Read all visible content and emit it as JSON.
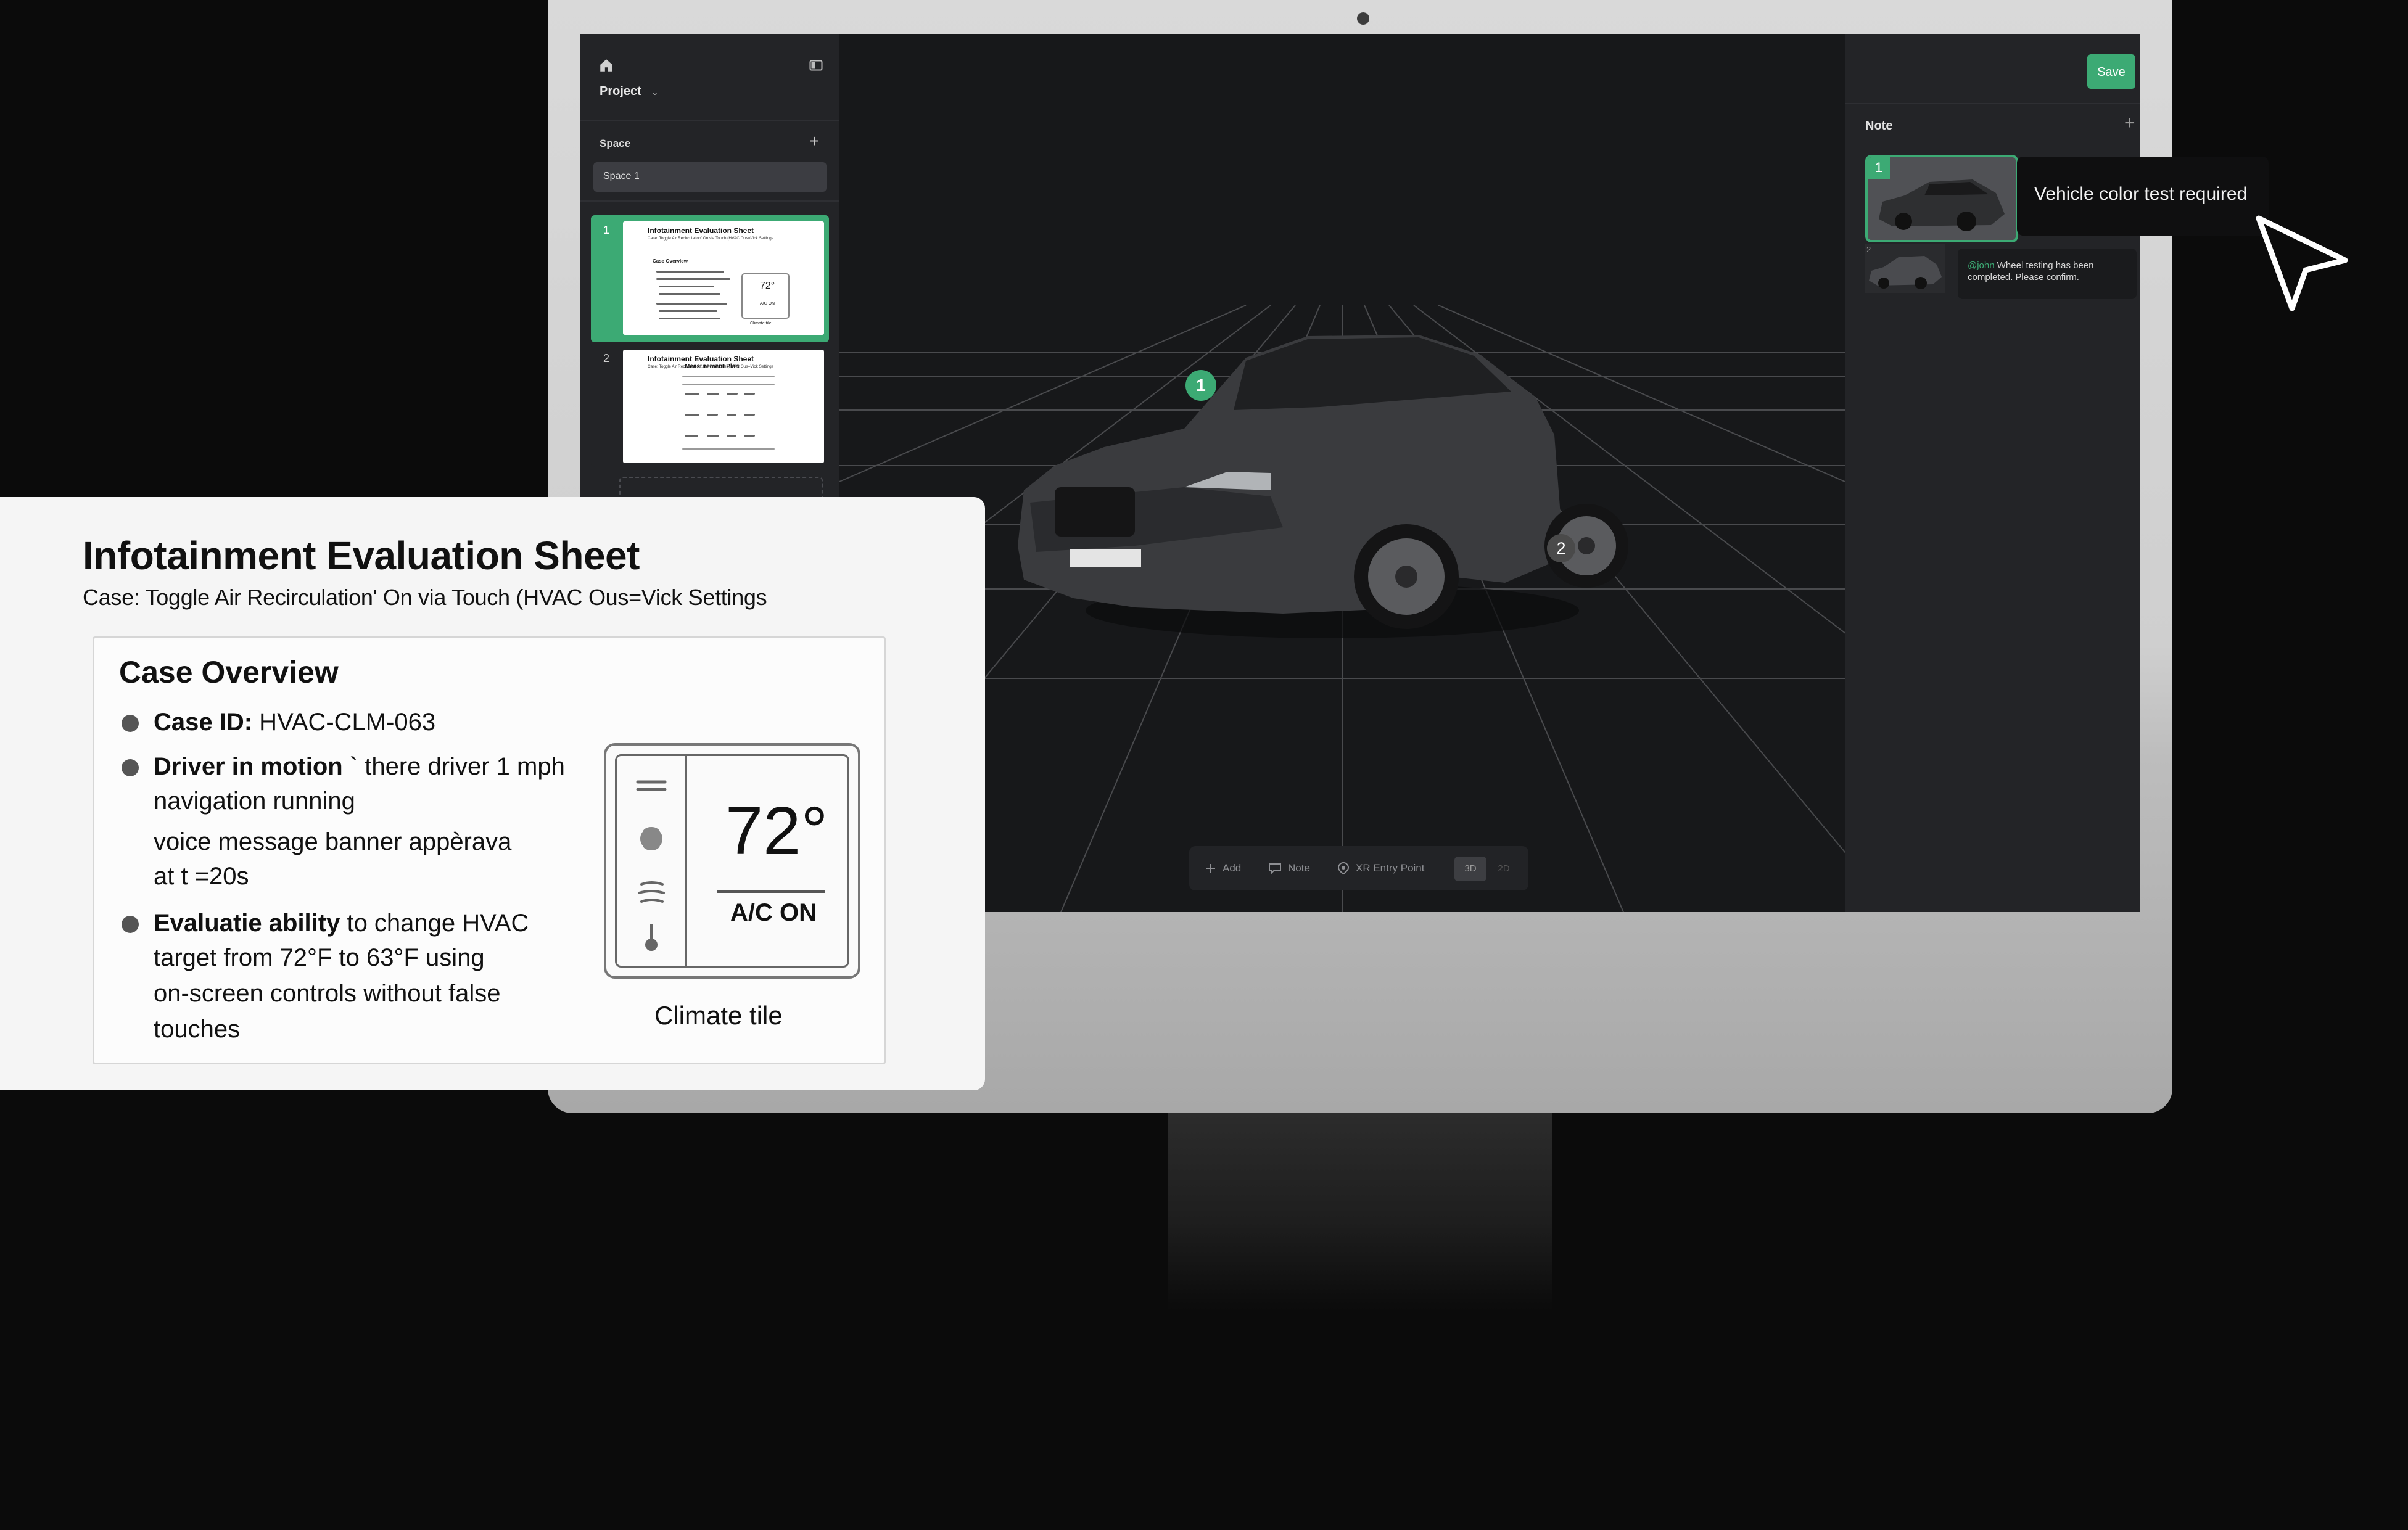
{
  "app": {
    "project_label": "Project",
    "space_section_label": "Space",
    "space_selected": "Space 1",
    "pages": [
      {
        "number": "1",
        "title": "Infotainment Evaluation Sheet",
        "subtitle": "Case: Toggle Air Recirculation' On via Touch (HVAC Ous=Vick Settings",
        "section": "Case Overview",
        "temp": "72°",
        "ac": "A/C ON",
        "caption": "Climate tile"
      },
      {
        "number": "2",
        "title": "Infotainment Evaluation Sheet",
        "subtitle": "Case: Toggle Air Recirculation' On via Touch (HVAC Ous=Vick Settings",
        "section": "Measurement Plan"
      }
    ]
  },
  "viewport": {
    "pins": [
      "1",
      "2"
    ],
    "toolbar": {
      "add_label": "Add",
      "note_label": "Note",
      "xr_label": "XR Entry Point",
      "view_3d": "3D",
      "view_2d": "2D",
      "active_view": "3D"
    }
  },
  "notes_panel": {
    "save_label": "Save",
    "heading": "Note",
    "notes": [
      {
        "number": "1",
        "text": "Vehicle color test required"
      },
      {
        "number": "2",
        "mention": "@john",
        "text": " Wheel testing has been completed. Please confirm."
      }
    ]
  },
  "doc_card": {
    "title": "Infotainment Evaluation Sheet",
    "subtitle": "Case: Toggle Air Recirculation' On via Touch (HVAC Ous=Vick Settings",
    "overview_heading": "Case Overview",
    "bullet_1_bold": "Case ID:",
    "bullet_1_text": " HVAC-CLM-063",
    "bullet_2_bold": "Driver in motion",
    "bullet_2_text": " ` there driver 1 mph",
    "bullet_2_line2": "navigation running",
    "bullet_2_line3": "voice message banner appèrava",
    "bullet_2_line4": "at t =20s",
    "bullet_3_bold": "Evaluatie ability",
    "bullet_3_text": " to change HVAC",
    "bullet_3_line2": "target from 72°F to 63°F using",
    "bullet_3_line3": "on-screen controls without false",
    "bullet_3_line4": "touches",
    "climate_temp": "72°",
    "climate_ac": "A/C ON",
    "climate_caption": "Climate tile"
  },
  "colors": {
    "accent": "#3caa74",
    "background": "#0b0b0b",
    "panel": "#232427",
    "viewport": "#17181a",
    "monitor_bezel": "#d9d9d9"
  },
  "icons": [
    "home-icon",
    "sidebar-collapse-icon",
    "chevron-down-icon",
    "plus-icon",
    "comment-icon",
    "location-pin-icon",
    "cursor-arrow-icon",
    "fan-icon",
    "thermometer-icon"
  ]
}
